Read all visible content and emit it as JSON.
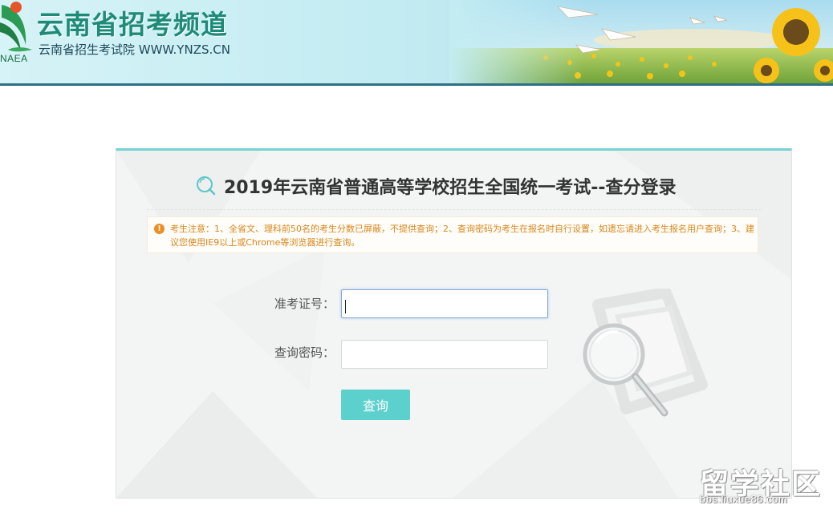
{
  "header": {
    "logo_text": "NAEA",
    "title": "云南省招考频道",
    "subtitle": "云南省招生考试院 WWW.YNZS.CN"
  },
  "panel": {
    "title": "2019年云南省普通高等学校招生全国统一考试--查分登录",
    "notice_icon": "!",
    "notice": "考生注意：1、全省文、理科前50名的考生分数已屏蔽，不提供查询；2、查询密码为考生在报名时自行设置，如遗忘请进入考生报名用户查询；3、建议您使用IE9以上或Chrome等浏览器进行查询。",
    "form": {
      "exam_id_label": "准考证号：",
      "exam_id_value": "",
      "password_label": "查询密码：",
      "password_value": "",
      "submit_label": "查询"
    }
  },
  "watermark": {
    "main": "留学社区",
    "sub": "bbs.liuxue86.com"
  },
  "colors": {
    "accent": "#5cd0cd",
    "panel_top_border": "#77d3d2",
    "header_title": "#1e8a78",
    "notice_text": "#d8861b",
    "notice_icon": "#ef8c22"
  },
  "icons": {
    "logo": "naea-logo-icon",
    "title": "search-icon",
    "notice": "warning-icon",
    "decoration": "magnifier-icon"
  }
}
